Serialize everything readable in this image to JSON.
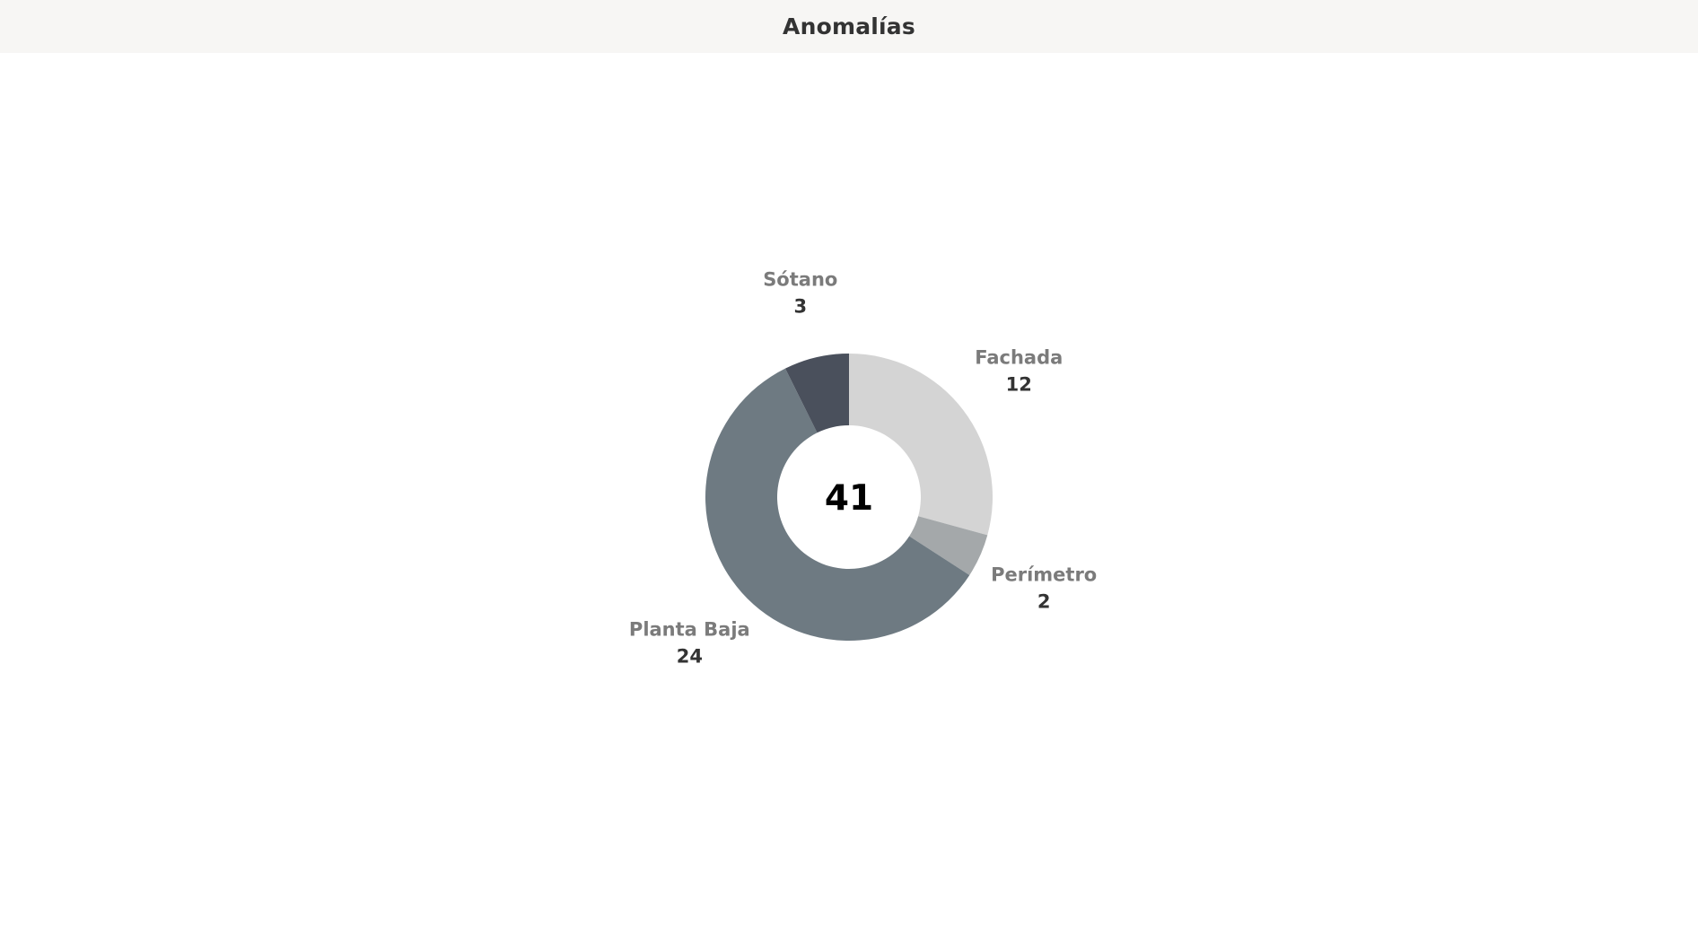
{
  "header": {
    "title": "Anomalías"
  },
  "chart_data": {
    "type": "pie",
    "title": "Anomalías",
    "total": "41",
    "slices": [
      {
        "label": "Fachada",
        "value": 12,
        "color": "#d4d4d4"
      },
      {
        "label": "Perímetro",
        "value": 2,
        "color": "#a4a8aa"
      },
      {
        "label": "Planta Baja",
        "value": 24,
        "color": "#6e7a82"
      },
      {
        "label": "Sótano",
        "value": 3,
        "color": "#4a505c"
      }
    ]
  }
}
